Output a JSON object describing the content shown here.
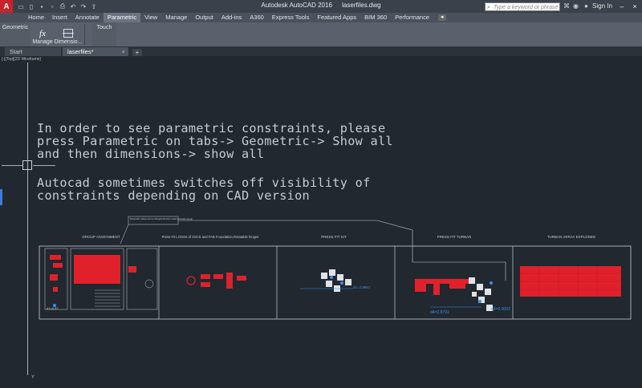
{
  "titlebar": {
    "app_title": "Autodesk AutoCAD 2016",
    "file_name": "laserfiles.dwg",
    "app_logo": "A",
    "search_placeholder": "Type a keyword or phrase",
    "sign_in": "Sign In",
    "icons": [
      "new-icon",
      "open-icon",
      "save-icon",
      "saveas-icon",
      "print-icon",
      "undo-icon",
      "redo-icon",
      "share-icon"
    ]
  },
  "ribbon_tabs": [
    "Home",
    "Insert",
    "Annotate",
    "Parametric",
    "View",
    "Manage",
    "Output",
    "Add-ins",
    "A360",
    "Express Tools",
    "Featured Apps",
    "BIM 360",
    "Performance"
  ],
  "ribbon_active_tab": "Parametric",
  "ribbon_panel": {
    "geometric": "Geometric",
    "manage": "Manage",
    "dimensions": "Dimensio...",
    "touch": "Touch",
    "fx_symbol": "fx"
  },
  "doc_tabs": {
    "start": "Start",
    "laser": "laserfiles*",
    "close": "×",
    "add": "+"
  },
  "canvas": {
    "viewport_label": "[-][Top][2D Wireframe]",
    "note1": [
      "In order to see parametric constraints, please",
      "press Parametric on tabs-> Geometric-> Show all",
      "and then dimensions-> show all"
    ],
    "note2": [
      "Autocad sometimes switches off visibility of",
      "constraints depending on CAD version"
    ],
    "y_axis": "Y",
    "callout": "Parametric values can be changed directly in each dimension group",
    "sections": [
      {
        "title": "GROUP ASSIGNMENT"
      },
      {
        "title": "Press Fit LOGOs of ZSCS and FAB Foundation,Rotatable hinges"
      },
      {
        "title": "PRESS FIT KIT"
      },
      {
        "title": "PRESS FIT TURBAN"
      },
      {
        "title": "TURBAN ARRAY EXPLODED"
      }
    ],
    "dimensions": [
      "d1=4.57",
      "d1=2.9967",
      "d4=2.8791",
      "d3=0.0003"
    ]
  },
  "colors": {
    "canvas_bg": "#212830",
    "drawing_red": "#e0212b",
    "constraint_blue": "#3d8ee6",
    "line_grey": "#c9ced4"
  }
}
